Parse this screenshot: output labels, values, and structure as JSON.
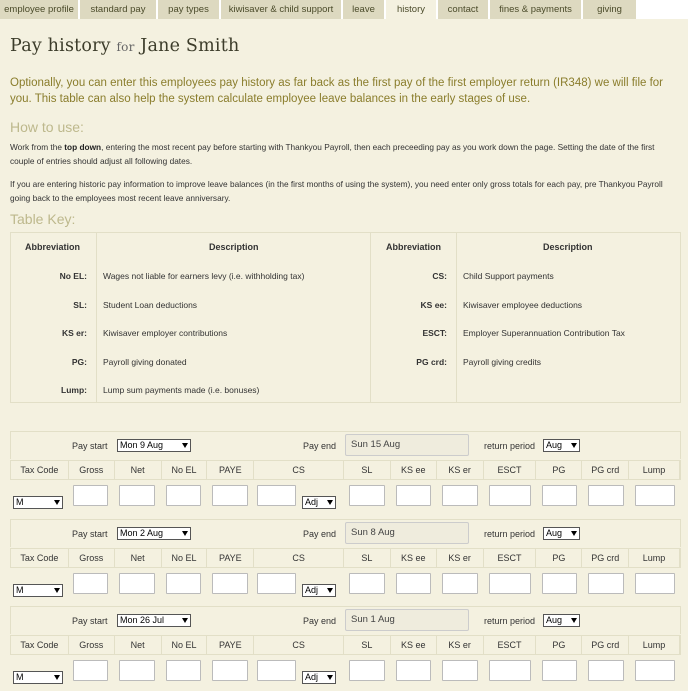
{
  "tabs": [
    {
      "label": "employee profile",
      "active": false
    },
    {
      "label": "standard pay",
      "active": false
    },
    {
      "label": "pay types",
      "active": false
    },
    {
      "label": "kiwisaver & child support",
      "active": false
    },
    {
      "label": "leave",
      "active": false
    },
    {
      "label": "history",
      "active": true
    },
    {
      "label": "contact",
      "active": false
    },
    {
      "label": "fines & payments",
      "active": false
    },
    {
      "label": "giving",
      "active": false
    }
  ],
  "page": {
    "title": "Pay history",
    "for_label": "for",
    "employee_name": "Jane Smith",
    "intro": "Optionally, you can enter this employees pay history as far back as the first pay of the first employer return (IR348) we will file for you. This table can also help the system calculate employee leave balances in the early stages of use.",
    "how_to_use_heading": "How to use:",
    "how1_pre": "Work from the ",
    "how1_bold": "top down",
    "how1_post": ", entering the most recent pay before starting with Thankyou Payroll, then each preceeding pay as you work down the page. Setting the date of the first couple of entries should adjust all following dates.",
    "how2": "If you are entering historic pay information to improve leave balances (in the first months of using the system), you need enter only gross totals for each pay, pre Thankyou Payroll going back to the employees most recent leave anniversary.",
    "table_key_heading": "Table Key:"
  },
  "table_key": {
    "headers": {
      "abbreviation": "Abbreviation",
      "description": "Description"
    },
    "left": [
      {
        "abbr": "No EL:",
        "desc": "Wages not liable for earners levy (i.e. withholding tax)"
      },
      {
        "abbr": "SL:",
        "desc": "Student Loan deductions"
      },
      {
        "abbr": "KS er:",
        "desc": "Kiwisaver employer contributions"
      },
      {
        "abbr": "PG:",
        "desc": "Payroll giving donated"
      },
      {
        "abbr": "Lump:",
        "desc": "Lump sum payments made (i.e. bonuses)"
      }
    ],
    "right": [
      {
        "abbr": "CS:",
        "desc": "Child Support payments"
      },
      {
        "abbr": "KS ee:",
        "desc": "Kiwisaver employee deductions"
      },
      {
        "abbr": "ESCT:",
        "desc": "Employer Superannuation Contribution Tax"
      },
      {
        "abbr": "PG crd:",
        "desc": "Payroll giving credits"
      }
    ]
  },
  "pay_labels": {
    "pay_start": "Pay start",
    "pay_end": "Pay end",
    "return_period": "return period",
    "columns": [
      "Tax Code",
      "Gross",
      "Net",
      "No EL",
      "PAYE",
      "CS",
      "SL",
      "KS ee",
      "KS er",
      "ESCT",
      "PG",
      "PG crd",
      "Lump"
    ],
    "adj": "Adj"
  },
  "pay_rows": [
    {
      "pay_start": "Mon 9 Aug",
      "pay_end": "Sun 15 Aug",
      "return_period": "Aug",
      "tax_code": "M"
    },
    {
      "pay_start": "Mon 2 Aug",
      "pay_end": "Sun 8 Aug",
      "return_period": "Aug",
      "tax_code": "M"
    },
    {
      "pay_start": "Mon 26 Jul",
      "pay_end": "Sun 1 Aug",
      "return_period": "Aug",
      "tax_code": "M"
    }
  ]
}
